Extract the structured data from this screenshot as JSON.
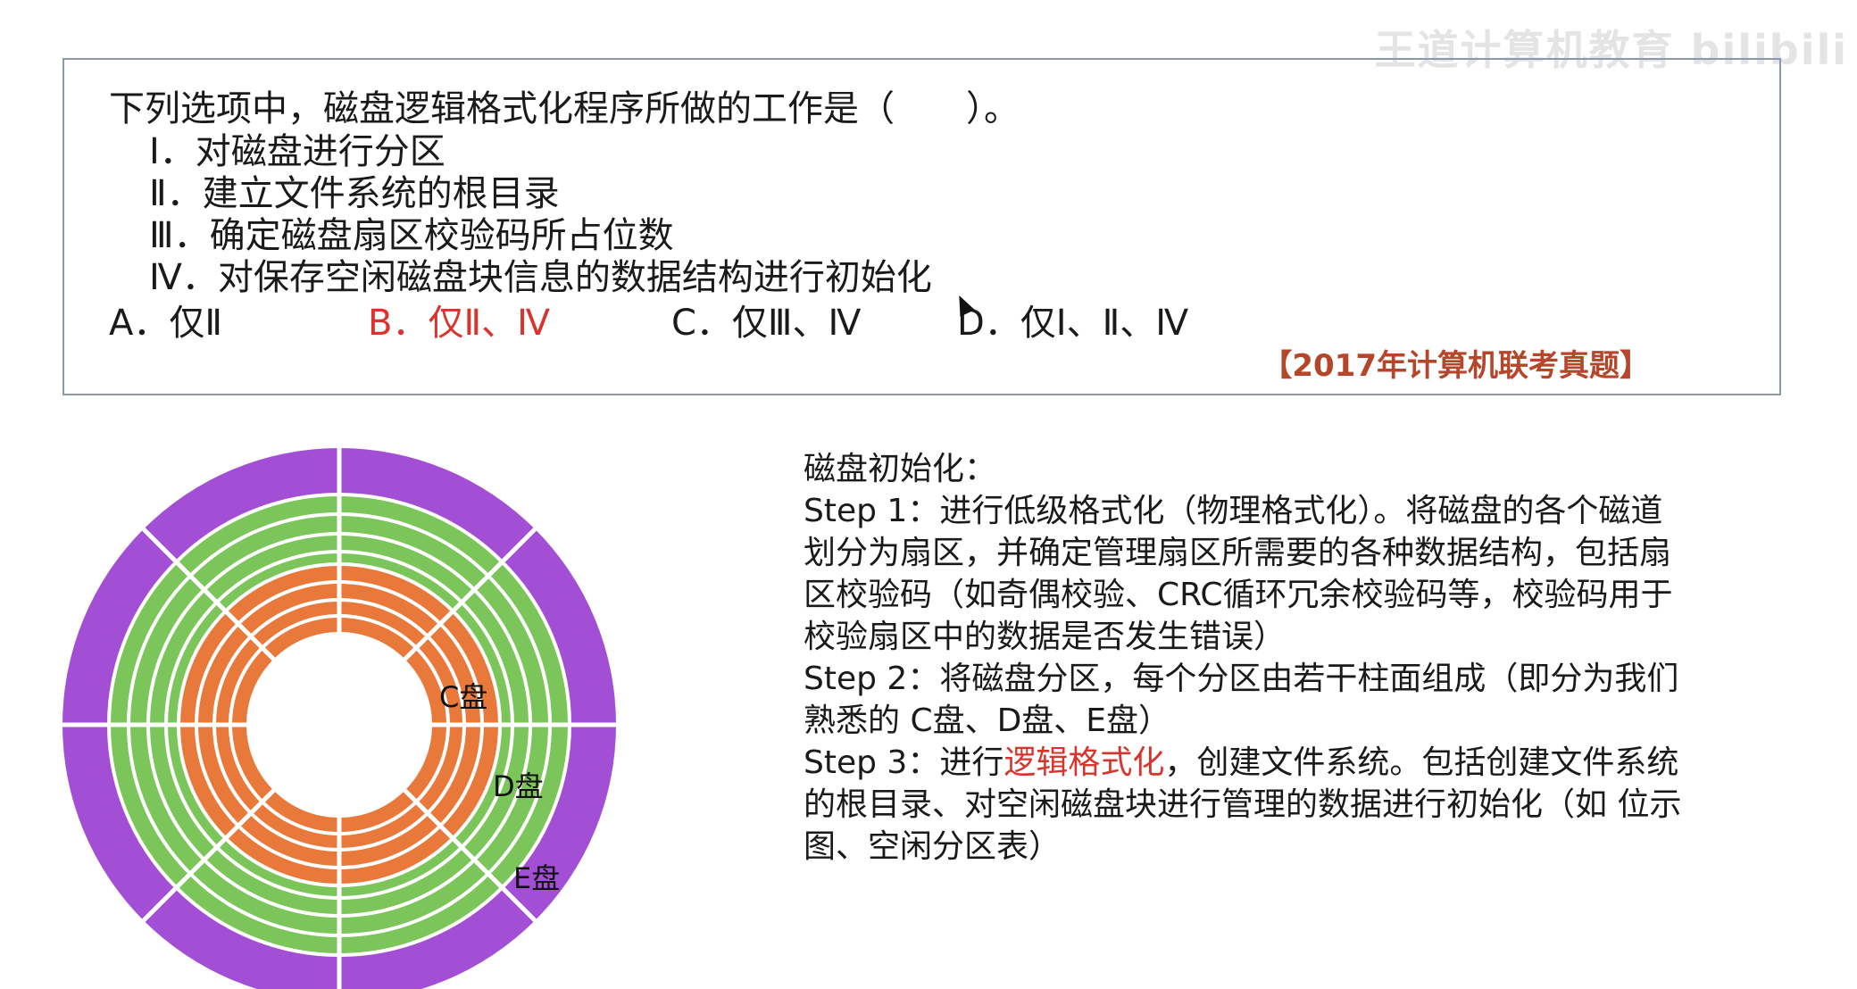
{
  "watermark": "王道计算机教育  bilibili",
  "question": {
    "title": "下列选项中，磁盘逻辑格式化程序所做的工作是（　　）。",
    "items": [
      "Ⅰ．对磁盘进行分区",
      "Ⅱ．建立文件系统的根目录",
      "Ⅲ．确定磁盘扇区校验码所占位数",
      "Ⅳ．对保存空闲磁盘块信息的数据结构进行初始化"
    ],
    "options": [
      {
        "label": "A．仅Ⅱ",
        "correct": false
      },
      {
        "label": "B．仅Ⅱ、Ⅳ",
        "correct": true
      },
      {
        "label": "C．仅Ⅲ、Ⅳ",
        "correct": false
      },
      {
        "label": "D．仅Ⅰ、Ⅱ、Ⅳ",
        "correct": false
      }
    ],
    "source": "【2017年计算机联考真题】"
  },
  "disk": {
    "labels": {
      "c": "C盘",
      "d": "D盘",
      "e": "E盘"
    },
    "colors": {
      "c": "#e8793a",
      "d": "#7cc55a",
      "e": "#a24fd6"
    }
  },
  "explanation": {
    "heading": "磁盘初始化：",
    "lines": [
      "Step 1：进行低级格式化（物理格式化）。将磁盘的各个磁道",
      "划分为扇区，并确定管理扇区所需要的各种数据结构，包括扇",
      "区校验码（如奇偶校验、CRC循环冗余校验码等，校验码用于",
      "校验扇区中的数据是否发生错误）",
      "Step 2：将磁盘分区，每个分区由若干柱面组成（即分为我们",
      "熟悉的 C盘、D盘、E盘）"
    ],
    "step3_prefix": "Step 3：进行",
    "step3_highlight": "逻辑格式化",
    "step3_suffix": "，创建文件系统。包括创建文件系统",
    "tail_lines": [
      "的根目录、对空闲磁盘块进行管理的数据进行初始化（如 位示",
      "图、空闲分区表）"
    ]
  }
}
